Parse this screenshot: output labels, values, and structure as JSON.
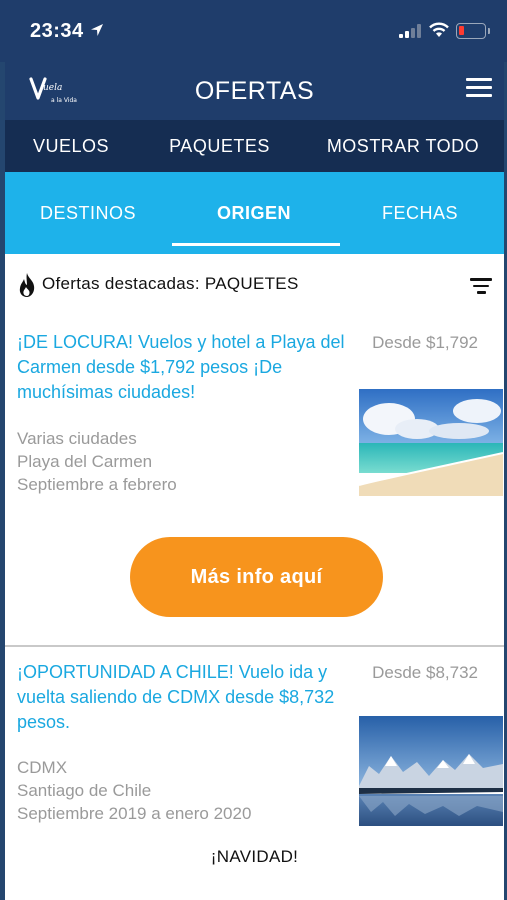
{
  "status": {
    "time": "23:34"
  },
  "header": {
    "title": "OFERTAS",
    "logo_text": "Vuela a la Vida"
  },
  "top_nav": {
    "vuelos": "VUELOS",
    "paquetes": "PAQUETES",
    "todo": "MOSTRAR TODO"
  },
  "sub_tabs": {
    "destinos": "DESTINOS",
    "origen": "ORIGEN",
    "fechas": "FECHAS",
    "active": "ORIGEN"
  },
  "featured": {
    "label": "Ofertas destacadas: PAQUETES"
  },
  "offers": [
    {
      "title": "¡DE LOCURA! Vuelos y hotel a Playa del Carmen desde $1,792 pesos ¡De muchísimas ciudades!",
      "price": "Desde $1,792",
      "origin": "Varias ciudades",
      "destination": "Playa del Carmen",
      "dates": "Septiembre a febrero",
      "button": "Más info aquí",
      "image_icon": "beach-photo"
    },
    {
      "title": "¡OPORTUNIDAD A CHILE! Vuelo ida y vuelta saliendo de CDMX desde $8,732 pesos.",
      "price": "Desde $8,732",
      "origin": "CDMX",
      "destination": "Santiago de Chile",
      "dates": "Septiembre 2019 a enero 2020",
      "image_icon": "mountain-lake-photo"
    }
  ],
  "next_section": "¡NAVIDAD!",
  "colors": {
    "header_bg": "#1f3d6b",
    "nav_bg": "#152d52",
    "tabs_bg": "#1eb2ea",
    "link": "#1aa8e0",
    "button": "#f7941d",
    "muted": "#9a9a9a"
  }
}
